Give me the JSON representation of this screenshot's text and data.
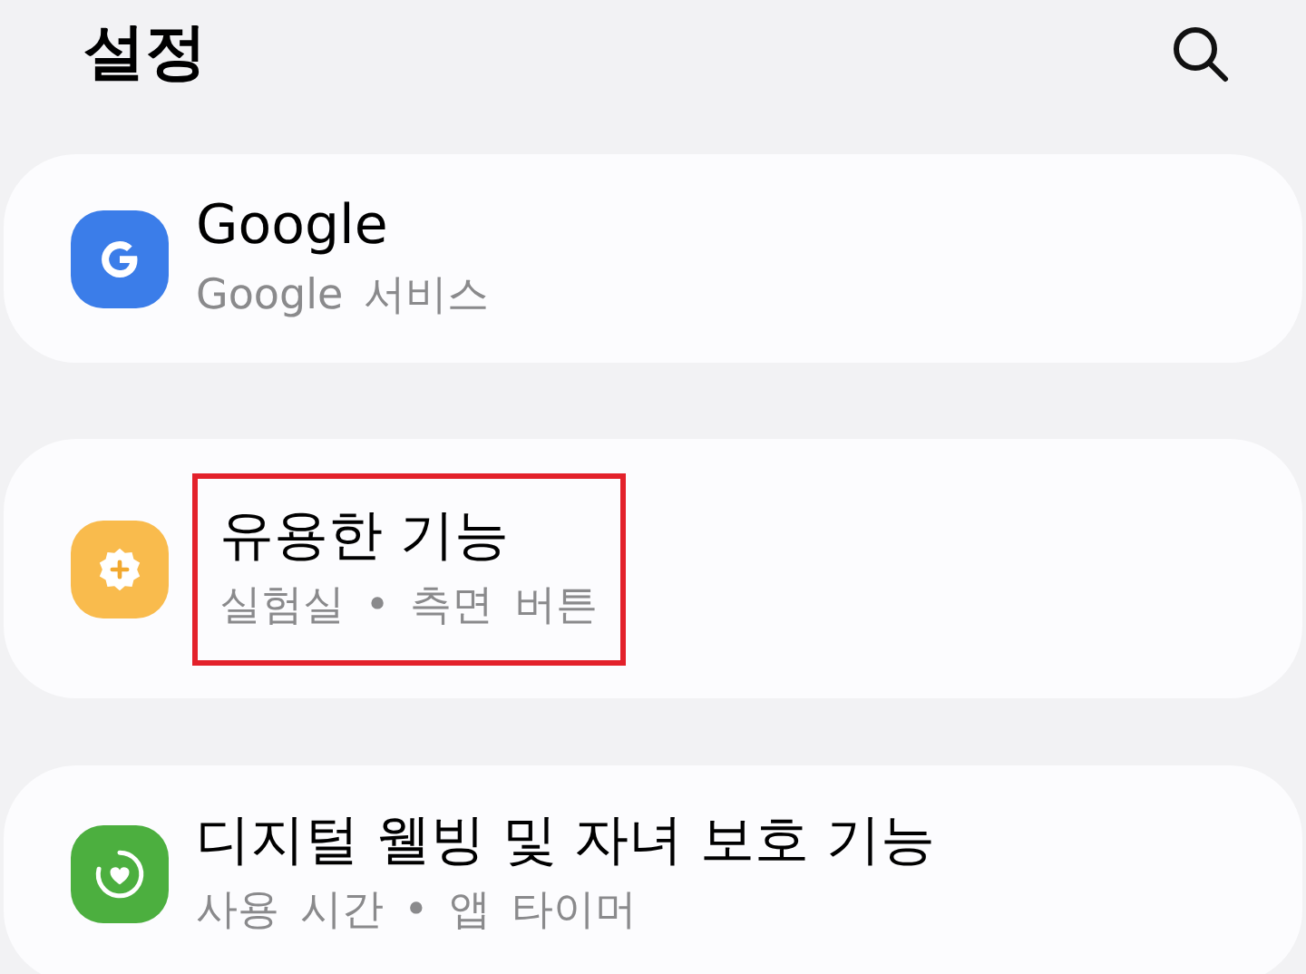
{
  "header": {
    "title": "설정"
  },
  "items": [
    {
      "kind": "google",
      "color": "#3b7de9",
      "title": "Google",
      "subtitle": "Google 서비스",
      "highlighted": false
    },
    {
      "kind": "gear",
      "color": "#f9bb4d",
      "title": "유용한 기능",
      "subtitle": "실험실 • 측면 버튼",
      "highlighted": true
    },
    {
      "kind": "wellbeing",
      "color": "#4caf3f",
      "title": "디지털 웰빙 및 자녀 보호 기능",
      "subtitle": "사용 시간 • 앱 타이머",
      "highlighted": false
    }
  ]
}
